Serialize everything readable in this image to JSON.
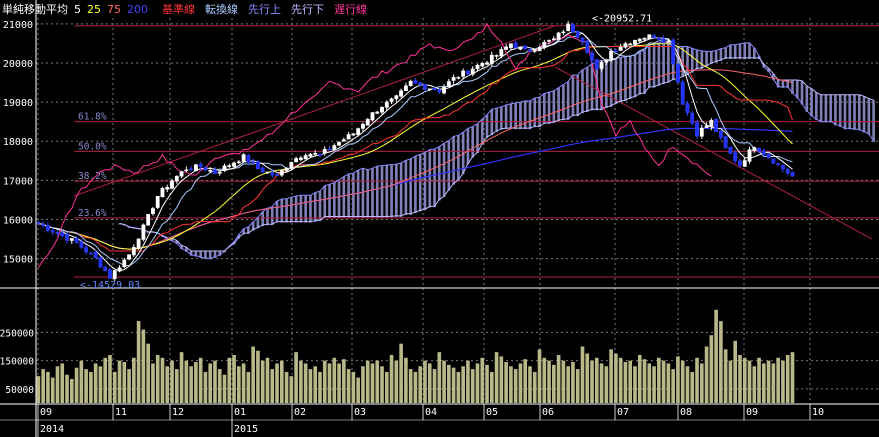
{
  "legend": {
    "title": "単純移動平均",
    "p5": "5",
    "p25": "25",
    "p75": "75",
    "p200": "200",
    "kijun": "基準線",
    "tenkan": "転換線",
    "senkou_a": "先行上",
    "senkou_b": "先行下",
    "chikou": "遅行線"
  },
  "colors": {
    "title": "#ffffff",
    "ma5": "#ffffff",
    "ma25": "#ffff33",
    "ma75": "#ff6666",
    "ma200": "#3333ff",
    "kijun": "#ff3333",
    "tenkan": "#aaccff",
    "senkou_a": "#8888ff",
    "senkou_b": "#bbbbff",
    "chikou": "#ff3399",
    "volume": "#b8b888",
    "fib": "#b02040",
    "cloud": "#8080b8",
    "grid": "#7a7a7a"
  },
  "annotations": {
    "high": "<-20952.71",
    "low": "<-14529.03"
  },
  "fib_labels": [
    "61.8%",
    "50.0%",
    "38.2%",
    "23.6%"
  ],
  "chart_data": {
    "type": "candlestick",
    "title": "",
    "price_axis": {
      "ticks": [
        "21000",
        "20000",
        "19000",
        "18000",
        "17000",
        "16000",
        "15000"
      ],
      "ylim": [
        14300,
        21150
      ]
    },
    "volume_axis": {
      "ticks": [
        "250000",
        "150000",
        "50000"
      ],
      "ylim": [
        0,
        400000
      ]
    },
    "x_ticks": [
      "09",
      "11",
      "12",
      "01",
      "02",
      "03",
      "04",
      "05",
      "06",
      "07",
      "08",
      "09",
      "10"
    ],
    "year_labels": [
      "2014",
      "2015"
    ],
    "high": 20952.71,
    "low": 14529.03,
    "fib_levels": [
      {
        "label": "61.8%",
        "value": 18500
      },
      {
        "label": "50.0%",
        "value": 17740
      },
      {
        "label": "38.2%",
        "value": 16980
      },
      {
        "label": "23.6%",
        "value": 16040
      }
    ],
    "price_path": [
      [
        0,
        15900
      ],
      [
        4,
        15650
      ],
      [
        8,
        15400
      ],
      [
        12,
        15000
      ],
      [
        15,
        14529
      ],
      [
        19,
        15100
      ],
      [
        22,
        15800
      ],
      [
        25,
        16600
      ],
      [
        28,
        17000
      ],
      [
        31,
        17300
      ],
      [
        34,
        17350
      ],
      [
        37,
        17200
      ],
      [
        40,
        17400
      ],
      [
        43,
        17600
      ],
      [
        46,
        17300
      ],
      [
        50,
        17100
      ],
      [
        53,
        17500
      ],
      [
        56,
        17700
      ],
      [
        59,
        17650
      ],
      [
        62,
        17900
      ],
      [
        66,
        18200
      ],
      [
        69,
        18600
      ],
      [
        72,
        18900
      ],
      [
        75,
        19100
      ],
      [
        78,
        19500
      ],
      [
        81,
        19400
      ],
      [
        84,
        19300
      ],
      [
        87,
        19600
      ],
      [
        90,
        19800
      ],
      [
        93,
        20000
      ],
      [
        96,
        20200
      ],
      [
        99,
        20500
      ],
      [
        102,
        20300
      ],
      [
        105,
        20450
      ],
      [
        108,
        20600
      ],
      [
        111,
        20952
      ],
      [
        114,
        20600
      ],
      [
        117,
        19800
      ],
      [
        120,
        20300
      ],
      [
        123,
        20500
      ],
      [
        126,
        20650
      ],
      [
        129,
        20700
      ],
      [
        132,
        20550
      ],
      [
        135,
        19000
      ],
      [
        138,
        18200
      ],
      [
        141,
        18500
      ],
      [
        144,
        17800
      ],
      [
        147,
        17400
      ],
      [
        150,
        17900
      ],
      [
        153,
        17600
      ],
      [
        156,
        17300
      ],
      [
        158,
        17100
      ]
    ],
    "total_bars": 176,
    "data_bars": 159,
    "volume_values": [
      95000,
      120000,
      110000,
      90000,
      130000,
      140000,
      100000,
      85000,
      125000,
      150000,
      120000,
      110000,
      140000,
      130000,
      160000,
      170000,
      110000,
      150000,
      145000,
      120000,
      160000,
      290000,
      260000,
      210000,
      140000,
      170000,
      160000,
      130000,
      150000,
      120000,
      180000,
      150000,
      130000,
      145000,
      160000,
      110000,
      140000,
      150000,
      120000,
      100000,
      160000,
      170000,
      130000,
      140000,
      110000,
      200000,
      185000,
      150000,
      160000,
      120000,
      140000,
      150000,
      110000,
      95000,
      180000,
      150000,
      140000,
      120000,
      130000,
      110000,
      150000,
      140000,
      160000,
      140000,
      155000,
      120000,
      110000,
      90000,
      130000,
      150000,
      140000,
      150000,
      130000,
      110000,
      170000,
      150000,
      210000,
      160000,
      120000,
      110000,
      130000,
      150000,
      140000,
      120000,
      180000,
      150000,
      135000,
      125000,
      110000,
      130000,
      150000,
      120000,
      140000,
      160000,
      135000,
      110000,
      180000,
      165000,
      145000,
      130000,
      120000,
      140000,
      155000,
      130000,
      110000,
      190000,
      160000,
      150000,
      135000,
      170000,
      150000,
      130000,
      145000,
      120000,
      200000,
      175000,
      150000,
      160000,
      140000,
      130000,
      190000,
      175000,
      160000,
      145000,
      150000,
      130000,
      170000,
      155000,
      140000,
      130000,
      160000,
      150000,
      140000,
      120000,
      165000,
      150000,
      130000,
      110000,
      160000,
      140000,
      200000,
      240000,
      330000,
      290000,
      190000,
      150000,
      220000,
      170000,
      160000,
      150000,
      130000,
      160000,
      140000,
      150000,
      140000,
      160000,
      150000,
      170000,
      180000
    ]
  }
}
